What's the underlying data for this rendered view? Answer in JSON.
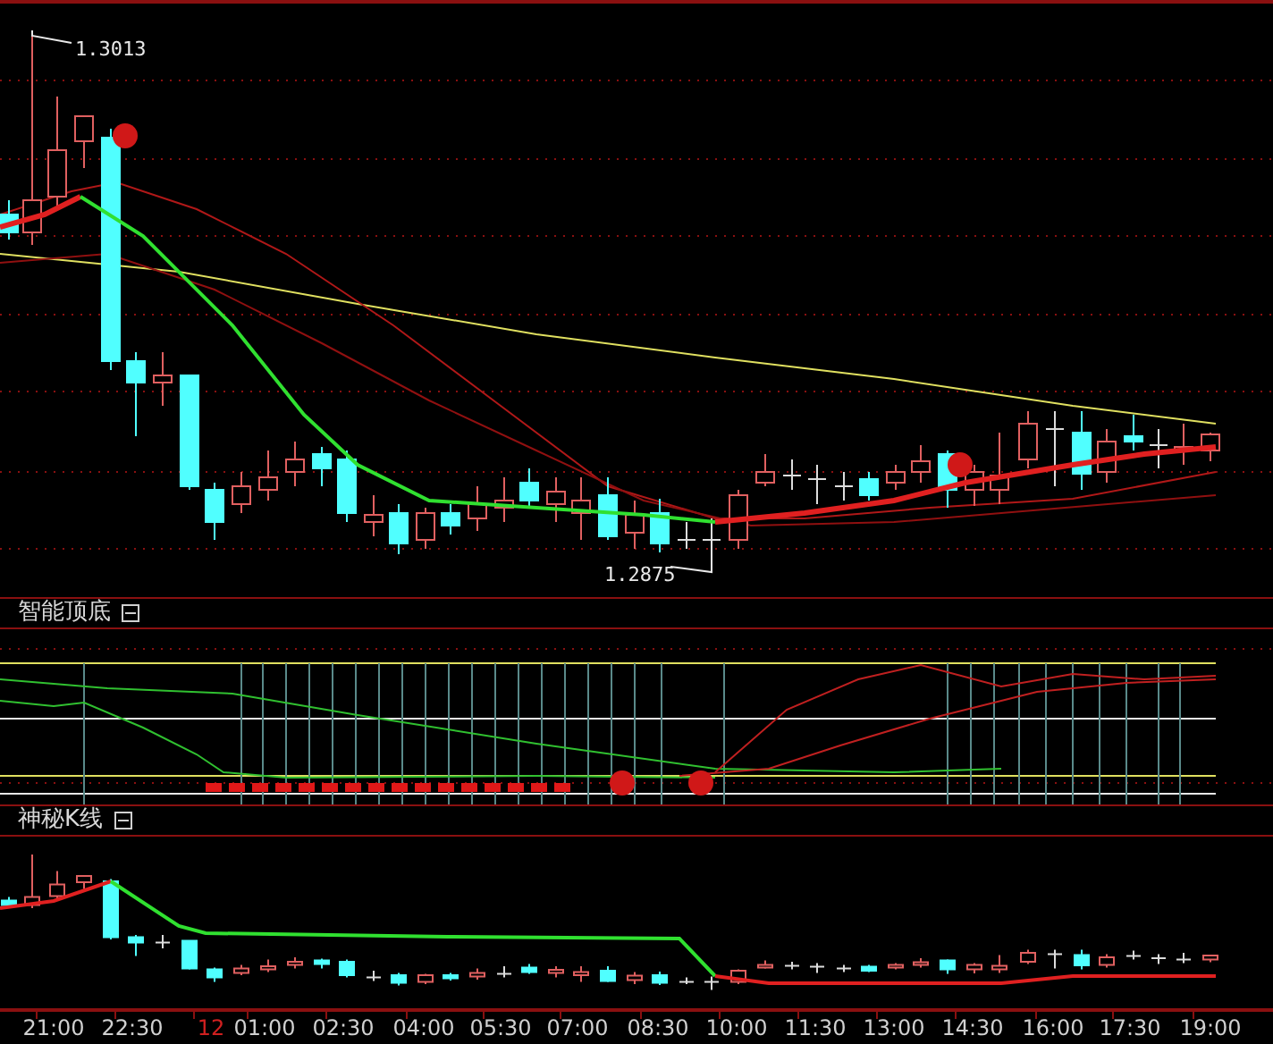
{
  "main_chart": {
    "high_label": "1.3013",
    "low_label": "1.2875"
  },
  "indicator_panels": [
    {
      "title": "智能顶底"
    },
    {
      "title": "神秘K线"
    }
  ],
  "time_axis": [
    {
      "label": "21:00",
      "kind": "time"
    },
    {
      "label": "22:30",
      "kind": "time"
    },
    {
      "label": "12",
      "kind": "date"
    },
    {
      "label": "01:00",
      "kind": "time"
    },
    {
      "label": "02:30",
      "kind": "time"
    },
    {
      "label": "04:00",
      "kind": "time"
    },
    {
      "label": "05:30",
      "kind": "time"
    },
    {
      "label": "07:00",
      "kind": "time"
    },
    {
      "label": "08:30",
      "kind": "time"
    },
    {
      "label": "10:00",
      "kind": "time"
    },
    {
      "label": "11:30",
      "kind": "time"
    },
    {
      "label": "13:00",
      "kind": "time"
    },
    {
      "label": "14:30",
      "kind": "time"
    },
    {
      "label": "16:00",
      "kind": "time"
    },
    {
      "label": "17:30",
      "kind": "time"
    },
    {
      "label": "19:00",
      "kind": "time"
    }
  ]
}
